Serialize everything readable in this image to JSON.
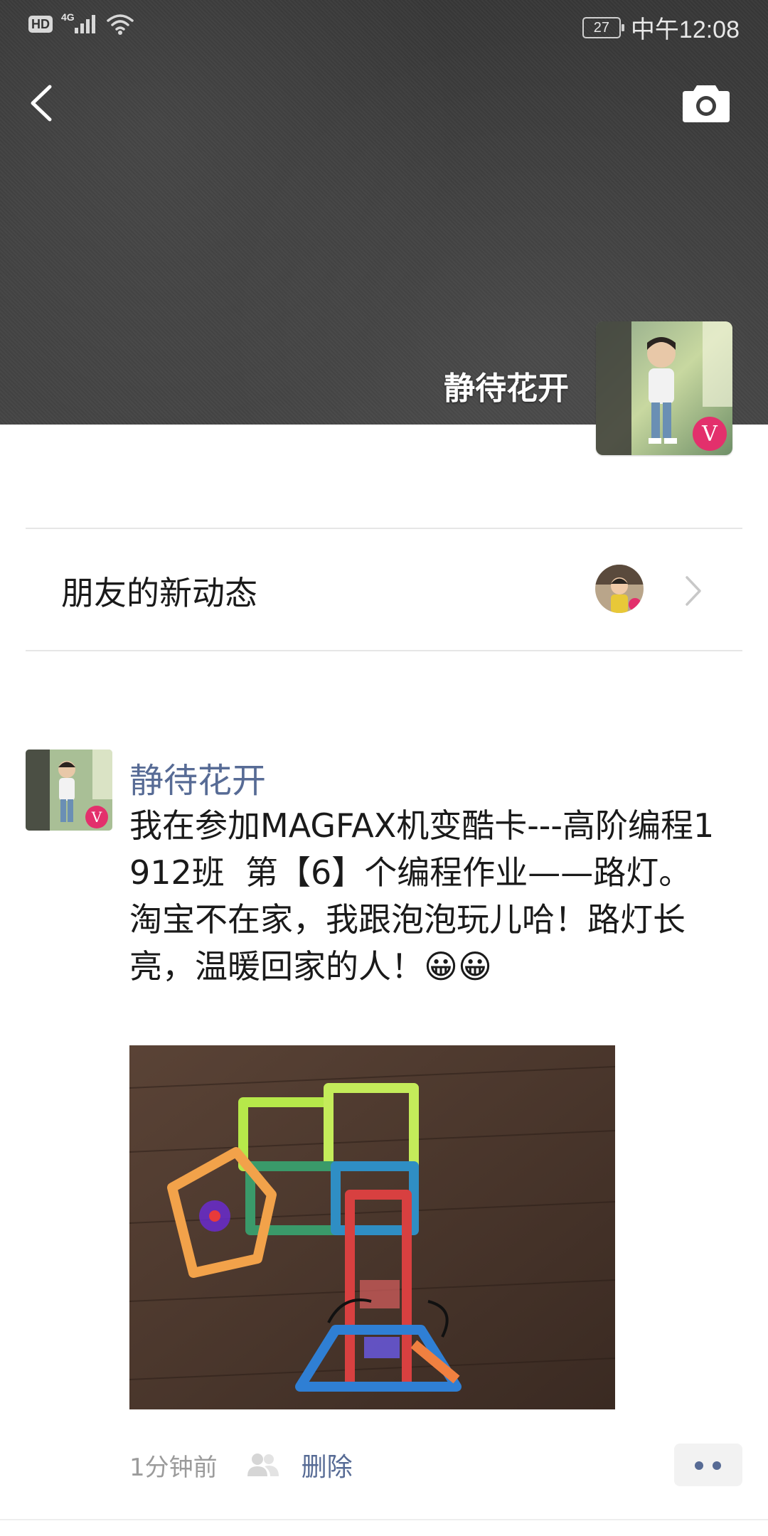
{
  "status_bar": {
    "hd_label": "HD",
    "network_label": "4G",
    "battery_level": "27",
    "time": "中午12:08"
  },
  "header": {
    "back_icon": "chevron-left-icon",
    "camera_icon": "camera-icon"
  },
  "profile": {
    "name": "静待花开",
    "avatar_badge": "V"
  },
  "friends_updates": {
    "label": "朋友的新动态"
  },
  "post": {
    "author": "静待花开",
    "avatar_badge": "V",
    "text": "我在参加MAGFAX机变酷卡---高阶编程1912班  第【6】个编程作业——路灯。\n淘宝不在家，我跟泡泡玩儿哈！路灯长亮，温暖回家的人！😀😀",
    "time": "1分钟前",
    "delete_label": "删除",
    "visibility_icon": "friends-icon",
    "more_icon": "more-dots-icon"
  },
  "colors": {
    "link_blue": "#576b95",
    "cover_bg": "#3e3e3e"
  }
}
